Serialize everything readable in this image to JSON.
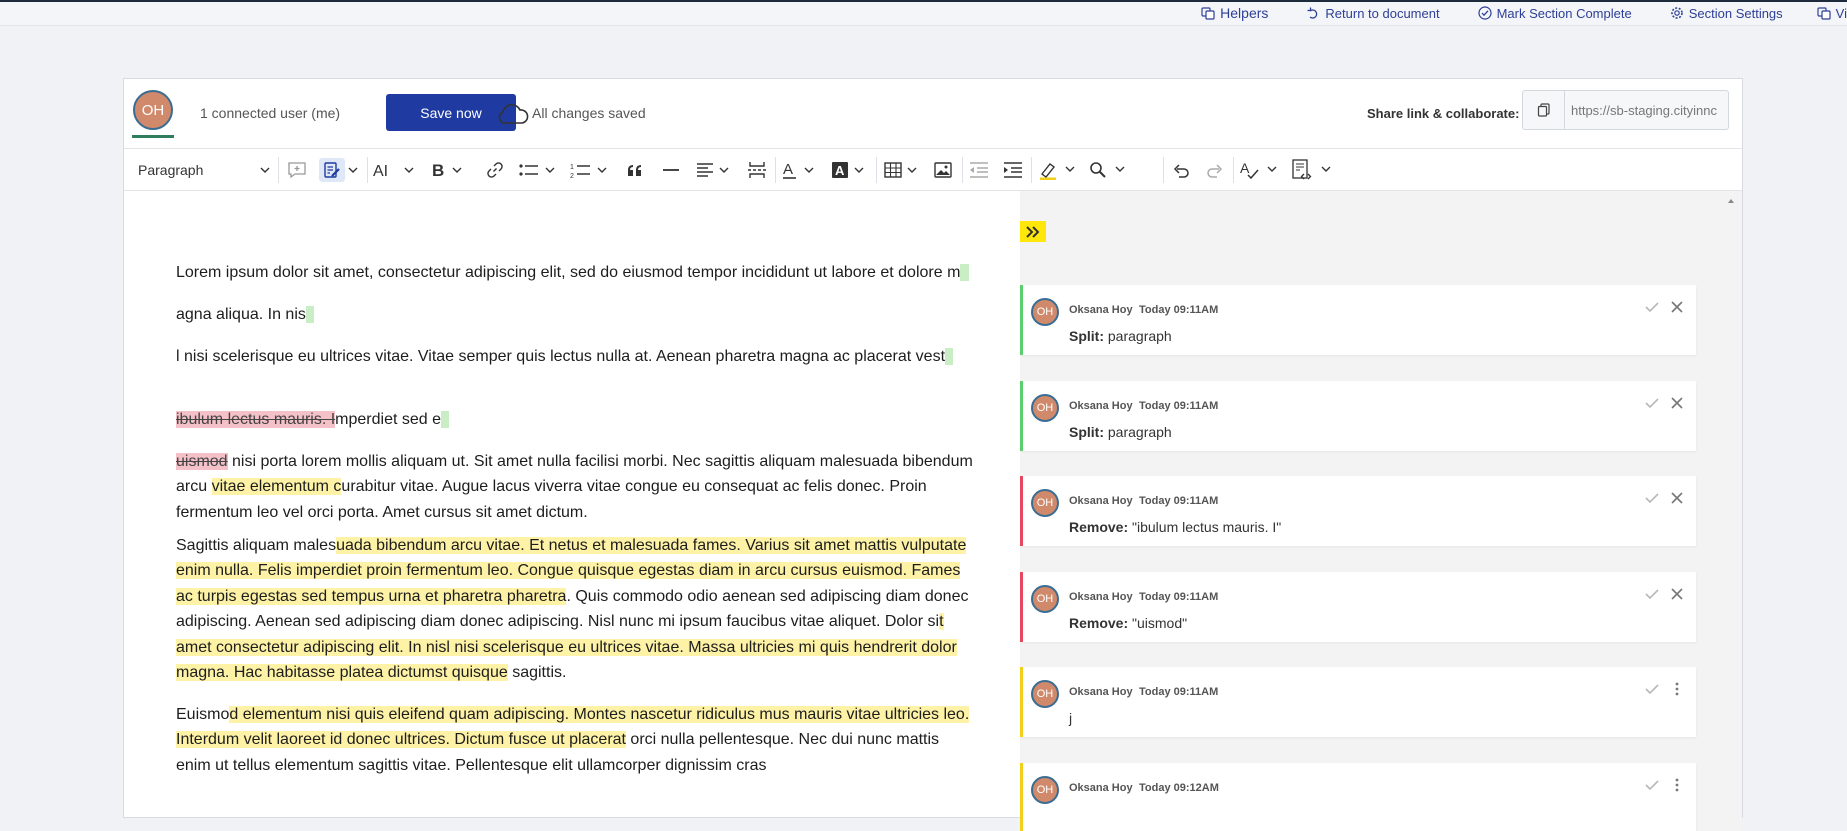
{
  "topnav": {
    "helpers": "Helpers",
    "return": "Return to document",
    "mark_complete": "Mark Section Complete",
    "section_settings": "Section Settings",
    "partial": "Vi"
  },
  "editor_header": {
    "user_initials": "OH",
    "connected": "1 connected user (me)",
    "save_label": "Save now",
    "status": "All changes saved",
    "share_label": "Share link & collaborate:",
    "share_url": "https://sb-staging.cityinnc"
  },
  "toolbar": {
    "paragraph_style": "Paragraph"
  },
  "document": {
    "paragraphs": [
      {
        "a": "Lorem ipsum dolor sit amet, consectetur adipiscing elit, sed do eiusmod tempor incididunt ut labore et dolore m"
      },
      {
        "a": "agna aliqua. In nis"
      },
      {
        "a": "l nisi scelerisque eu ultrices vitae. Vitae semper quis lectus nulla at. Aenean pharetra magna ac placerat vest"
      },
      {
        "del": "ibulum lectus mauris. I",
        "a": "mperdiet sed e"
      },
      {
        "del": "uismod",
        "a": " nisi porta lorem mollis aliquam ut. Sit amet nulla facilisi morbi. Nec sagittis aliquam malesuada bibendum arcu ",
        "hl": "vitae elementum c",
        "b": "urabitur vitae. Augue lacus viverra vitae congue eu consequat ac felis donec. Proin fermentum leo vel orci porta. Amet cursus sit amet dictum."
      },
      {
        "a": "Sagittis aliquam males",
        "hl": "uada bibendum arcu vitae. Et netus et malesuada fames. Varius sit amet mattis vulputate enim nulla. Felis imperdiet proin fermentum leo. Congue quisque egestas diam in arcu cursus euismod. Fames ac turpis egestas sed tempus urna et pharetra pharetra",
        "b": ". Quis commodo odio aenean sed adipiscing diam donec adipiscing. Aenean sed adipiscing diam donec adipiscing. Nisl nunc mi ipsum faucibus vitae aliquet. Dolor si",
        "hl2": "t amet consectetur adipiscing elit. In nisl nisi scelerisque eu ultrices vitae. Massa ultricies mi quis hendrerit dolor magna. Hac habitasse platea dictumst quisque",
        "c": " sagittis."
      },
      {
        "a": "Euismo",
        "hl": "d elementum nisi quis eleifend quam adipiscing. Montes nascetur ridiculus mus mauris vitae ultricies leo. Interdum velit laoreet id donec ultrices. Dictum fusce ut placerat",
        "b": " orci nulla pellentesque. Nec dui nunc mattis enim ut tellus elementum sagittis vitae. Pellentesque elit ullamcorper dignissim cras"
      }
    ]
  },
  "comments": [
    {
      "initials": "OH",
      "author": "Oksana Hoy",
      "time": "Today 09:11AM",
      "kind": "Split:",
      "text": "paragraph"
    },
    {
      "initials": "OH",
      "author": "Oksana Hoy",
      "time": "Today 09:11AM",
      "kind": "Split:",
      "text": "paragraph"
    },
    {
      "initials": "OH",
      "author": "Oksana Hoy",
      "time": "Today 09:11AM",
      "kind": "Remove:",
      "text": "\"ibulum lectus mauris. I\""
    },
    {
      "initials": "OH",
      "author": "Oksana Hoy",
      "time": "Today 09:11AM",
      "kind": "Remove:",
      "text": "\"uismod\""
    },
    {
      "initials": "OH",
      "author": "Oksana Hoy",
      "time": "Today 09:11AM",
      "kind": "",
      "text": "j"
    },
    {
      "initials": "OH",
      "author": "Oksana Hoy",
      "time": "Today 09:12AM",
      "kind": "",
      "text": ""
    }
  ],
  "colors": {
    "accent": "#1f3aa0",
    "insert": "#5bcf6e",
    "remove": "#e5485f",
    "comment": "#f2cf18",
    "highlight": "#fdf2a6"
  }
}
